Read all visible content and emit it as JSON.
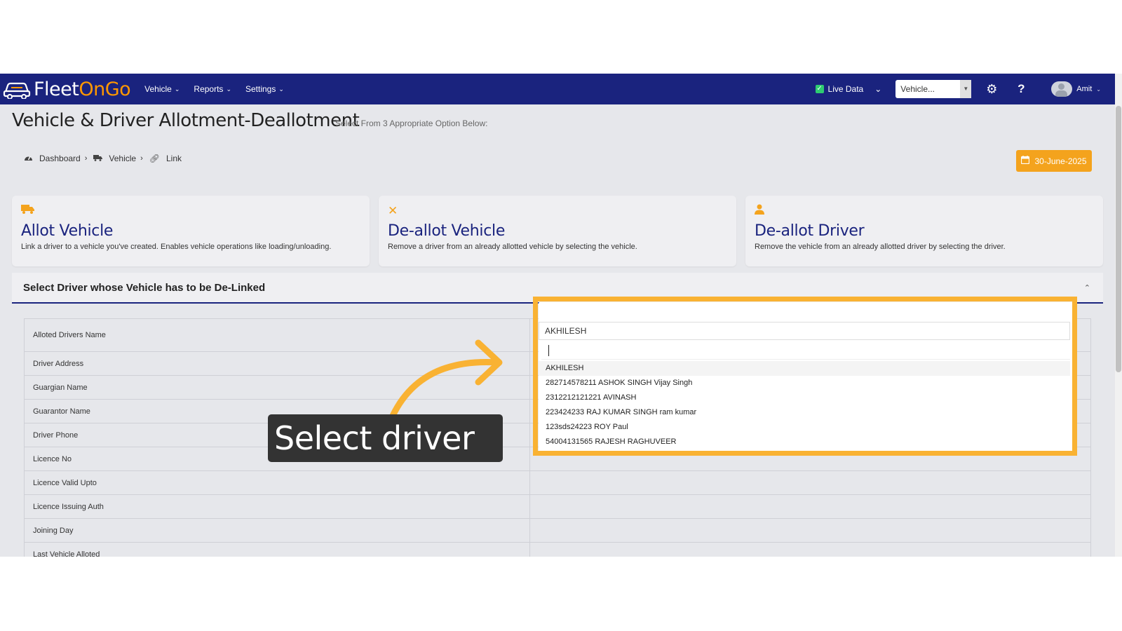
{
  "nav": {
    "logo_part1": "Fleet",
    "logo_part2": "OnGo",
    "menu": [
      {
        "label": "Vehicle"
      },
      {
        "label": "Reports"
      },
      {
        "label": "Settings"
      }
    ],
    "live_data_label": "Live Data",
    "live_data_checked": true,
    "vehicle_select_value": "Vehicle...",
    "user_name": "Amit"
  },
  "page": {
    "title": "Vehicle & Driver Allotment-Deallotment",
    "subtitle": "Select From 3 Appropriate Option Below:",
    "date": "30-June-2025"
  },
  "breadcrumb": [
    {
      "label": "Dashboard",
      "icon": "tachometer-icon"
    },
    {
      "label": "Vehicle",
      "icon": "truck-icon"
    },
    {
      "label": "Link",
      "icon": "link-icon"
    }
  ],
  "cards": [
    {
      "title": "Allot Vehicle",
      "desc": "Link a driver to a vehicle you've created. Enables vehicle operations like loading/unloading.",
      "icon": "truck-icon"
    },
    {
      "title": "De-allot Vehicle",
      "desc": "Remove a driver from an already allotted vehicle by selecting the vehicle.",
      "icon": "close-icon"
    },
    {
      "title": "De-allot Driver",
      "desc": "Remove the vehicle from an already allotted driver by selecting the driver.",
      "icon": "user-icon"
    }
  ],
  "section": {
    "title": "Select Driver whose Vehicle has to be De-Linked"
  },
  "table": {
    "rows": [
      {
        "label": "Alloted Drivers Name"
      },
      {
        "label": "Driver Address"
      },
      {
        "label": "Guargian Name"
      },
      {
        "label": "Guarantor Name"
      },
      {
        "label": "Driver Phone"
      },
      {
        "label": "Licence No"
      },
      {
        "label": "Licence Valid Upto"
      },
      {
        "label": "Licence Issuing Auth"
      },
      {
        "label": "Joining Day"
      },
      {
        "label": "Last Vehicle Alloted"
      }
    ]
  },
  "dropdown": {
    "selected": "AKHILESH",
    "search_value": "",
    "options": [
      "AKHILESH",
      "282714578211 ASHOK SINGH Vijay Singh",
      "2312212121221 AVINASH",
      "223424233 RAJ KUMAR SINGH ram kumar",
      "123sds24223 ROY Paul",
      "54004131565 RAJESH RAGHUVEER"
    ]
  },
  "annotation": {
    "callout": "Select driver",
    "accent_color": "#f9b233"
  },
  "colors": {
    "navbar": "#1a237e",
    "accent": "#f4a31d",
    "card_title": "#1a237e"
  }
}
